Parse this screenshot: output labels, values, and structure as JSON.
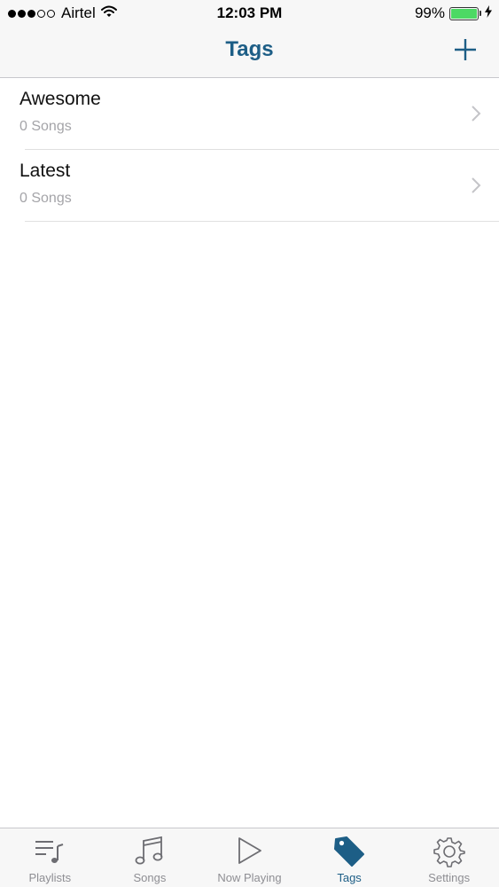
{
  "status_bar": {
    "signal": {
      "filled": 3,
      "total": 5
    },
    "carrier": "Airtel",
    "time": "12:03 PM",
    "battery_percent": "99%",
    "battery_level": 0.99,
    "charging": true
  },
  "nav": {
    "title": "Tags",
    "add_icon": "plus-icon"
  },
  "tags": [
    {
      "name": "Awesome",
      "count": "0 Songs"
    },
    {
      "name": "Latest",
      "count": "0 Songs"
    }
  ],
  "tab_bar": {
    "active": "Tags",
    "tabs": [
      {
        "label": "Playlists",
        "icon": "playlists-icon"
      },
      {
        "label": "Songs",
        "icon": "music-note-icon"
      },
      {
        "label": "Now Playing",
        "icon": "play-icon"
      },
      {
        "label": "Tags",
        "icon": "tag-icon"
      },
      {
        "label": "Settings",
        "icon": "gear-icon"
      }
    ]
  },
  "colors": {
    "accent": "#1d5e86",
    "battery": "#4cd964",
    "inactive": "#8e8e93"
  }
}
